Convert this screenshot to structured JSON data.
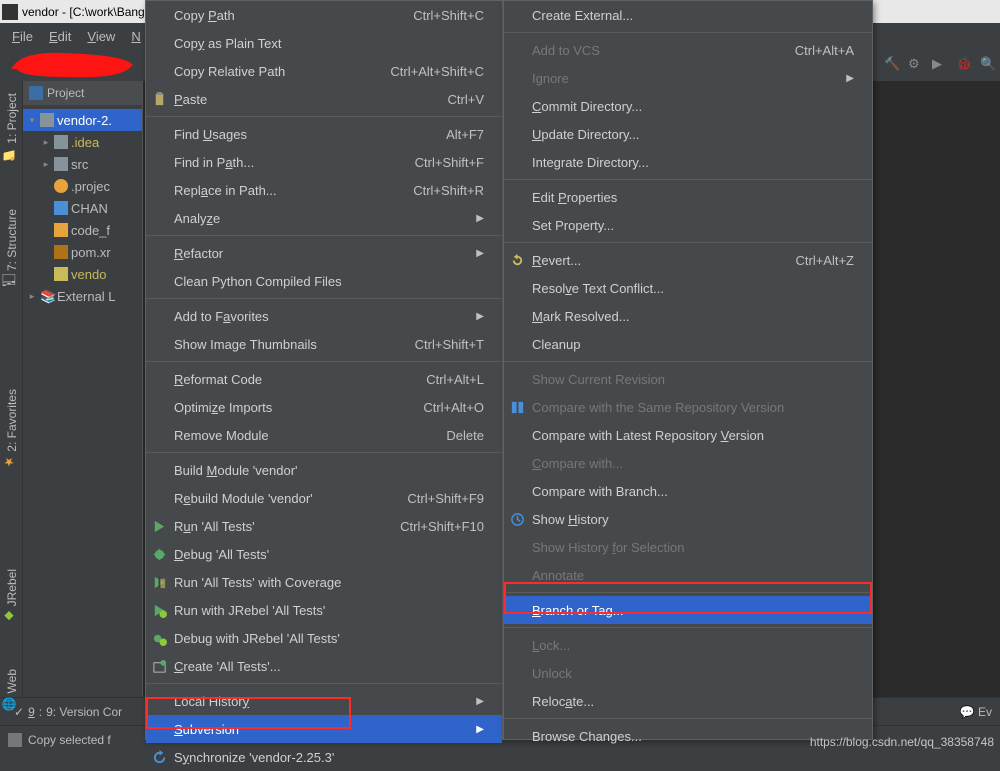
{
  "titlebar": "vendor - [C:\\work\\Bang",
  "menubar": {
    "file": "File",
    "edit": "Edit",
    "view": "View",
    "nav": "N"
  },
  "sidebar": {
    "project": "1: Project",
    "structure": "7: Structure",
    "favorites": "2: Favorites",
    "jrebel": "JRebel",
    "web": "Web"
  },
  "toolwindow": {
    "header": "Project"
  },
  "tree": {
    "root": "vendor-2.",
    "idea": ".idea",
    "src": "src",
    "projec": ".projec",
    "chang": "CHAN",
    "codef": "code_f",
    "pom": "pom.xr",
    "vendo": "vendo",
    "ext": "External L"
  },
  "menu1": [
    {
      "label": "Copy <u>P</u>ath",
      "sc": "Ctrl+Shift+C"
    },
    {
      "label": "Cop<u>y</u> as Plain Text"
    },
    {
      "label": "Copy Relative Path",
      "sc": "Ctrl+Alt+Shift+C"
    },
    {
      "label": "<u>P</u>aste",
      "sc": "Ctrl+V",
      "icon": "paste"
    },
    {
      "sep": true
    },
    {
      "label": "Find <u>U</u>sages",
      "sc": "Alt+F7"
    },
    {
      "label": "Find in P<u>a</u>th...",
      "sc": "Ctrl+Shift+F"
    },
    {
      "label": "Repl<u>a</u>ce in Path...",
      "sc": "Ctrl+Shift+R"
    },
    {
      "label": "Analy<u>z</u>e",
      "arrow": true
    },
    {
      "sep": true
    },
    {
      "label": "<u>R</u>efactor",
      "arrow": true
    },
    {
      "label": "Clean Python Compiled Files"
    },
    {
      "sep": true
    },
    {
      "label": "Add to F<u>a</u>vorites",
      "arrow": true
    },
    {
      "label": "Show Image Thumbnails",
      "sc": "Ctrl+Shift+T"
    },
    {
      "sep": true
    },
    {
      "label": "<u>R</u>eformat Code",
      "sc": "Ctrl+Alt+L"
    },
    {
      "label": "Optimi<u>z</u>e Imports",
      "sc": "Ctrl+Alt+O"
    },
    {
      "label": "Remove Module",
      "sc": "Delete"
    },
    {
      "sep": true
    },
    {
      "label": "Build <u>M</u>odule 'vendor'"
    },
    {
      "label": "R<u>e</u>build Module 'vendor'",
      "sc": "Ctrl+Shift+F9"
    },
    {
      "label": "R<u>u</u>n 'All Tests'",
      "sc": "Ctrl+Shift+F10",
      "icon": "run"
    },
    {
      "label": "<u>D</u>ebug 'All Tests'",
      "icon": "debug"
    },
    {
      "label": "Run 'All Tests' with Coverage",
      "icon": "coverage"
    },
    {
      "label": "Run with JRebel 'All Tests'",
      "icon": "jrebel-run"
    },
    {
      "label": "Debug with JRebel 'All Tests'",
      "icon": "jrebel-debug"
    },
    {
      "label": "<u>C</u>reate 'All Tests'...",
      "icon": "create"
    },
    {
      "sep": true
    },
    {
      "label": "Local Histor<u>y</u>",
      "arrow": true
    },
    {
      "label": "<u>S</u>ubversion",
      "arrow": true,
      "sel": true
    },
    {
      "label": "S<u>y</u>nchronize 'vendor-2.25.3'",
      "icon": "sync"
    }
  ],
  "menu2": [
    {
      "label": "Create External..."
    },
    {
      "sep": true
    },
    {
      "label": "Add to VCS",
      "sc": "Ctrl+Alt+A",
      "dis": true
    },
    {
      "label": "Ignore",
      "arrow": true,
      "dis": true
    },
    {
      "label": "<u>C</u>ommit Directory..."
    },
    {
      "label": "<u>U</u>pdate Directory..."
    },
    {
      "label": "Integrate Directory..."
    },
    {
      "sep": true
    },
    {
      "label": "Edit <u>P</u>roperties"
    },
    {
      "label": "Set Property..."
    },
    {
      "sep": true
    },
    {
      "label": "<u>R</u>evert...",
      "sc": "Ctrl+Alt+Z",
      "icon": "revert"
    },
    {
      "label": "Resol<u>v</u>e Text Conflict..."
    },
    {
      "label": "<u>M</u>ark Resolved..."
    },
    {
      "label": "Cleanup"
    },
    {
      "sep": true
    },
    {
      "label": "Show Current Revision",
      "dis": true
    },
    {
      "label": "Compare with the Same Repository Version",
      "dis": true,
      "icon": "compare"
    },
    {
      "label": "Compare with Latest Repository <u>V</u>ersion"
    },
    {
      "label": "<u>C</u>ompare with...",
      "dis": true
    },
    {
      "label": "Compare with Branch..."
    },
    {
      "label": "Show <u>H</u>istory",
      "icon": "history"
    },
    {
      "label": "Show History <u>f</u>or Selection",
      "dis": true
    },
    {
      "label": "Annotate",
      "dis": true
    },
    {
      "sep": true
    },
    {
      "label": "<u>B</u>ranch or Tag...",
      "sel": true
    },
    {
      "sep": true
    },
    {
      "label": "<u>L</u>ock...",
      "dis": true
    },
    {
      "label": "Unlock",
      "dis": true
    },
    {
      "label": "Reloc<u>a</u>te..."
    },
    {
      "sep": true
    },
    {
      "label": "Browse Changes..."
    }
  ],
  "bottom": {
    "vc": "9: Version Cor",
    "status": "Copy selected f",
    "ev": "Ev"
  },
  "watermark": "https://blog.csdn.net/qq_38358748"
}
